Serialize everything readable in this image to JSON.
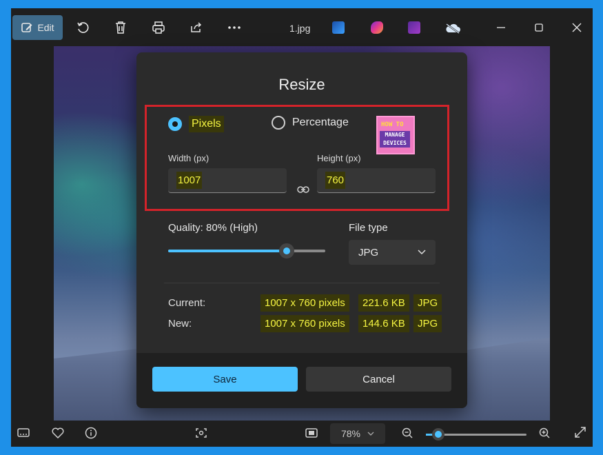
{
  "toolbar": {
    "edit_label": "Edit",
    "filename": "1.jpg",
    "icons": [
      "edit-icon",
      "rotate-icon",
      "delete-icon",
      "print-icon",
      "share-icon",
      "more-icon",
      "photos-app-icon",
      "designer-icon",
      "clipchamp-icon",
      "onedrive-icon",
      "minimize-icon",
      "maximize-icon",
      "close-icon"
    ]
  },
  "dialog": {
    "title": "Resize",
    "mode_options": {
      "pixels": "Pixels",
      "percentage": "Percentage"
    },
    "selected_mode": "Pixels",
    "logo": {
      "line1": "HOW TO",
      "line2": "MANAGE",
      "line3": "DEVICES"
    },
    "width_label": "Width  (px)",
    "height_label": "Height  (px)",
    "width_value": "1007",
    "height_value": "760",
    "quality_label": "Quality: 80% (High)",
    "quality_percent": 80,
    "filetype_label": "File type",
    "filetype_value": "JPG",
    "current_label": "Current:",
    "new_label": "New:",
    "current": {
      "dims": "1007 x 760 pixels",
      "size": "221.6 KB",
      "type": "JPG"
    },
    "new": {
      "dims": "1007 x 760 pixels",
      "size": "144.6 KB",
      "type": "JPG"
    },
    "save_label": "Save",
    "cancel_label": "Cancel"
  },
  "bottombar": {
    "zoom_value": "78%",
    "zoom_fraction": 0.12
  },
  "colors": {
    "accent": "#4cc2ff",
    "highlight_text": "#f5f542",
    "red_outline": "#d3232a",
    "frame_blue": "#1e90e8"
  }
}
